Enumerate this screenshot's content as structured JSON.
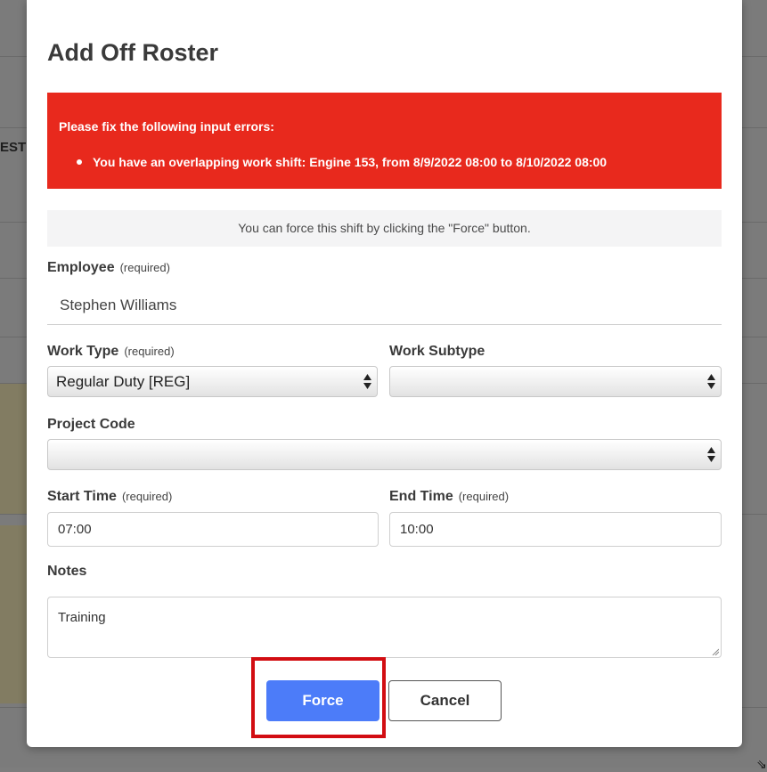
{
  "background": {
    "partial_text": "EST"
  },
  "modal": {
    "title": "Add Off Roster",
    "error": {
      "heading": "Please fix the following input errors:",
      "items": [
        "You have an overlapping work shift: Engine 153, from 8/9/2022 08:00 to 8/10/2022 08:00"
      ]
    },
    "force_note": "You can force this shift by clicking the \"Force\" button.",
    "required_tag": "(required)",
    "employee": {
      "label": "Employee",
      "value": "Stephen Williams"
    },
    "work_type": {
      "label": "Work Type",
      "value": "Regular Duty [REG]"
    },
    "work_subtype": {
      "label": "Work Subtype",
      "value": ""
    },
    "project_code": {
      "label": "Project Code",
      "value": ""
    },
    "start_time": {
      "label": "Start Time",
      "value": "07:00"
    },
    "end_time": {
      "label": "End Time",
      "value": "10:00"
    },
    "notes": {
      "label": "Notes",
      "value": "Training"
    },
    "buttons": {
      "force": "Force",
      "cancel": "Cancel"
    }
  },
  "colors": {
    "error_background": "#e8291d",
    "force_button": "#4c7cf9",
    "highlight_border": "#d20d12"
  }
}
